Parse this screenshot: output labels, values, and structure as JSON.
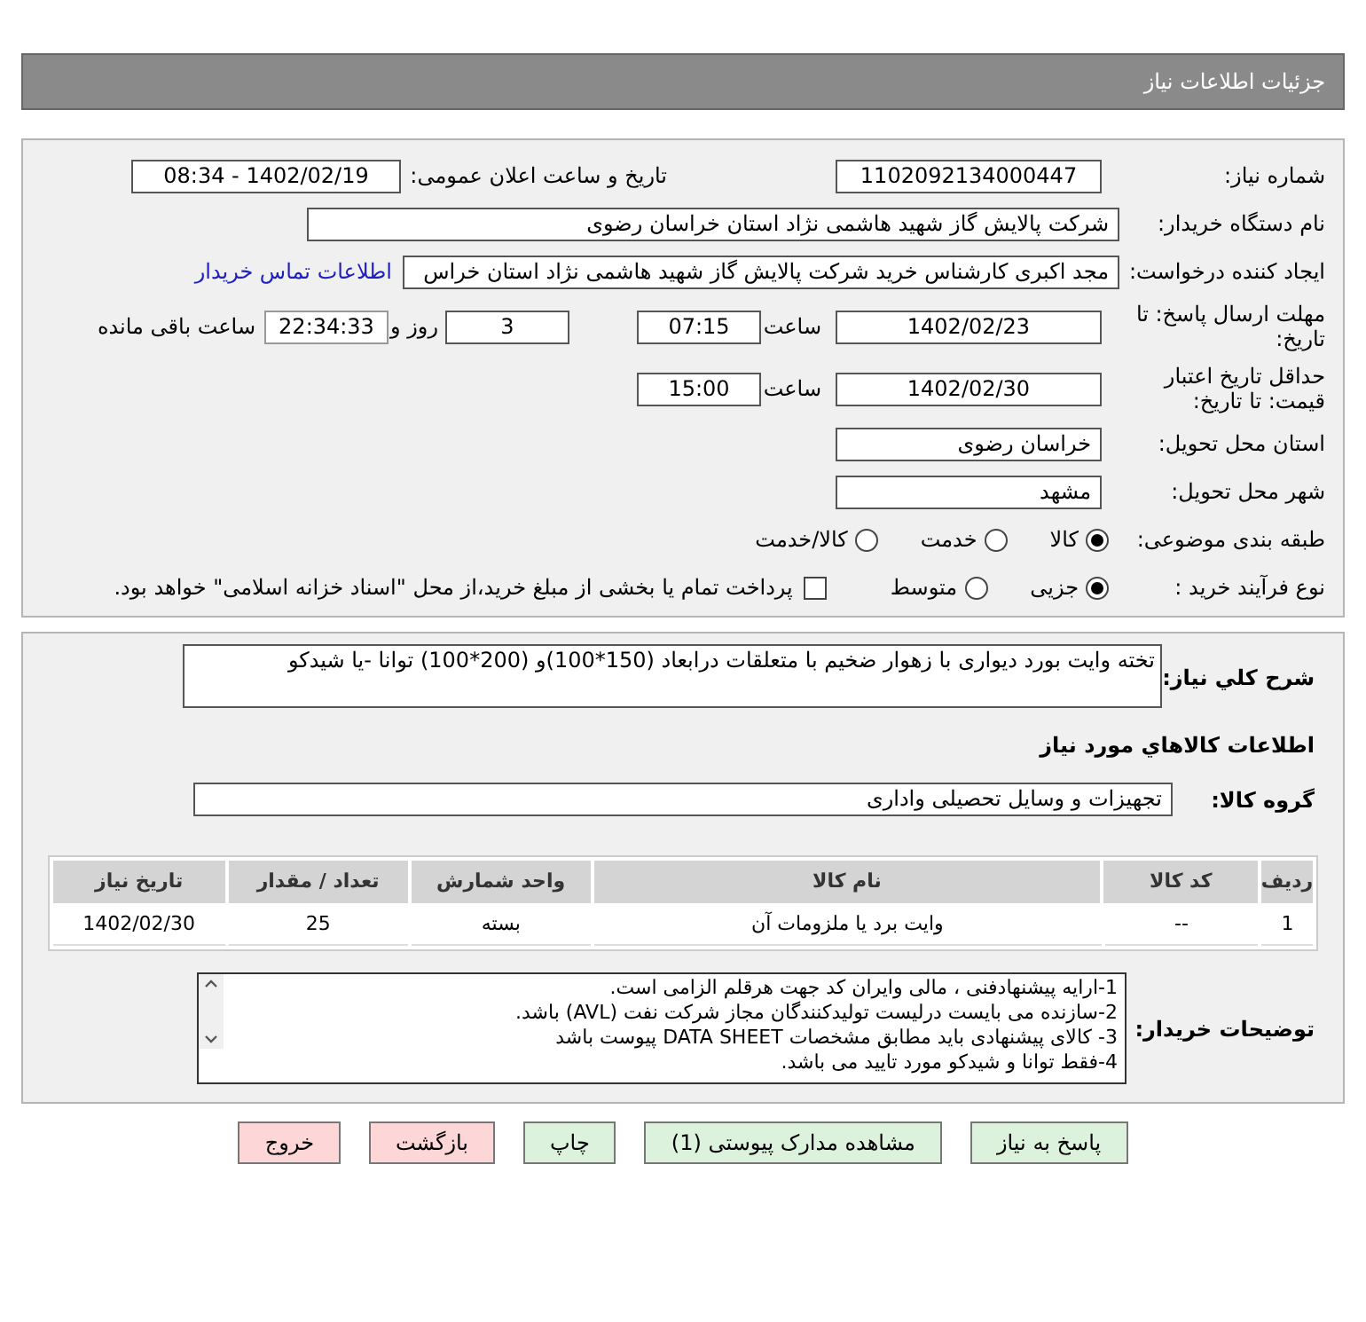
{
  "header": {
    "title": "جزئیات اطلاعات نیاز"
  },
  "info": {
    "need_number": {
      "label": "شماره نیاز:",
      "value": "1102092134000447"
    },
    "announce": {
      "label": "تاریخ و ساعت اعلان عمومی:",
      "value": "1402/02/19 - 08:34"
    },
    "buyer": {
      "label": "نام دستگاه خریدار:",
      "value": "شرکت پالایش گاز شهید هاشمی نژاد   استان خراسان رضوی"
    },
    "requester": {
      "label": "ایجاد کننده درخواست:",
      "value": "مجد اکبری کارشناس خرید شرکت پالایش گاز شهید هاشمی نژاد   استان خراس",
      "link": "اطلاعات تماس خریدار"
    },
    "deadline": {
      "label": "مهلت ارسال پاسخ: تا تاریخ:",
      "date": "1402/02/23",
      "time_label": "ساعت",
      "time": "07:15",
      "days": "3",
      "days_label": "روز و",
      "remaining": "22:34:33",
      "remaining_label": "ساعت باقی مانده"
    },
    "validity": {
      "label": "حداقل تاریخ اعتبار قیمت: تا تاریخ:",
      "date": "1402/02/30",
      "time_label": "ساعت",
      "time": "15:00"
    },
    "province": {
      "label": "استان محل تحویل:",
      "value": "خراسان رضوی"
    },
    "city": {
      "label": "شهر محل تحویل:",
      "value": "مشهد"
    },
    "category": {
      "label": "طبقه بندی موضوعی:",
      "options": [
        {
          "label": "کالا",
          "selected": true
        },
        {
          "label": "خدمت",
          "selected": false
        },
        {
          "label": "کالا/خدمت",
          "selected": false
        }
      ]
    },
    "process": {
      "label": "نوع فرآیند خرید :",
      "options": [
        {
          "label": "جزیی",
          "selected": true
        },
        {
          "label": "متوسط",
          "selected": false
        }
      ],
      "payment": {
        "checked": false,
        "text": "پرداخت تمام یا بخشی از مبلغ خرید،از محل \"اسناد خزانه اسلامی\" خواهد بود."
      }
    }
  },
  "details": {
    "summary": {
      "label": "شرح کلي نياز:",
      "value": "تخته وایت بورد دیواری با زهوار ضخیم با متعلقات درابعاد (150*100)و (200*100) توانا -یا شیدکو"
    },
    "goods_heading": "اطلاعات کالاهاي مورد نياز",
    "group": {
      "label": "گروه کالا:",
      "value": "تجهیزات و وسایل تحصیلی واداری"
    },
    "table": {
      "columns": [
        "ردیف",
        "کد کالا",
        "نام کالا",
        "واحد شمارش",
        "تعداد / مقدار",
        "تاریخ نیاز"
      ],
      "rows": [
        [
          "1",
          "--",
          "وایت برد یا ملزومات آن",
          "بسته",
          "25",
          "1402/02/30"
        ]
      ]
    },
    "notes": {
      "label": "توضیحات خریدار:",
      "lines": [
        "1-ارایه پیشنهادفنی ، مالی وایران کد جهت هرقلم الزامی است.",
        "2-سازنده می بایست درلیست تولیدکنندگان مجاز شرکت نفت (AVL)  باشد.",
        "3- کالای پیشنهادی باید مطابق مشخصات DATA SHEET پیوست باشد",
        "4-فقط توانا و شیدکو مورد تایید می باشد."
      ]
    }
  },
  "buttons": [
    {
      "label": "پاسخ به نیاز",
      "kind": "primary"
    },
    {
      "label": "مشاهده مدارک پیوستی (1)",
      "kind": "primary"
    },
    {
      "label": "چاپ",
      "kind": "primary"
    },
    {
      "label": "بازگشت",
      "kind": "danger"
    },
    {
      "label": "خروج",
      "kind": "danger"
    }
  ]
}
